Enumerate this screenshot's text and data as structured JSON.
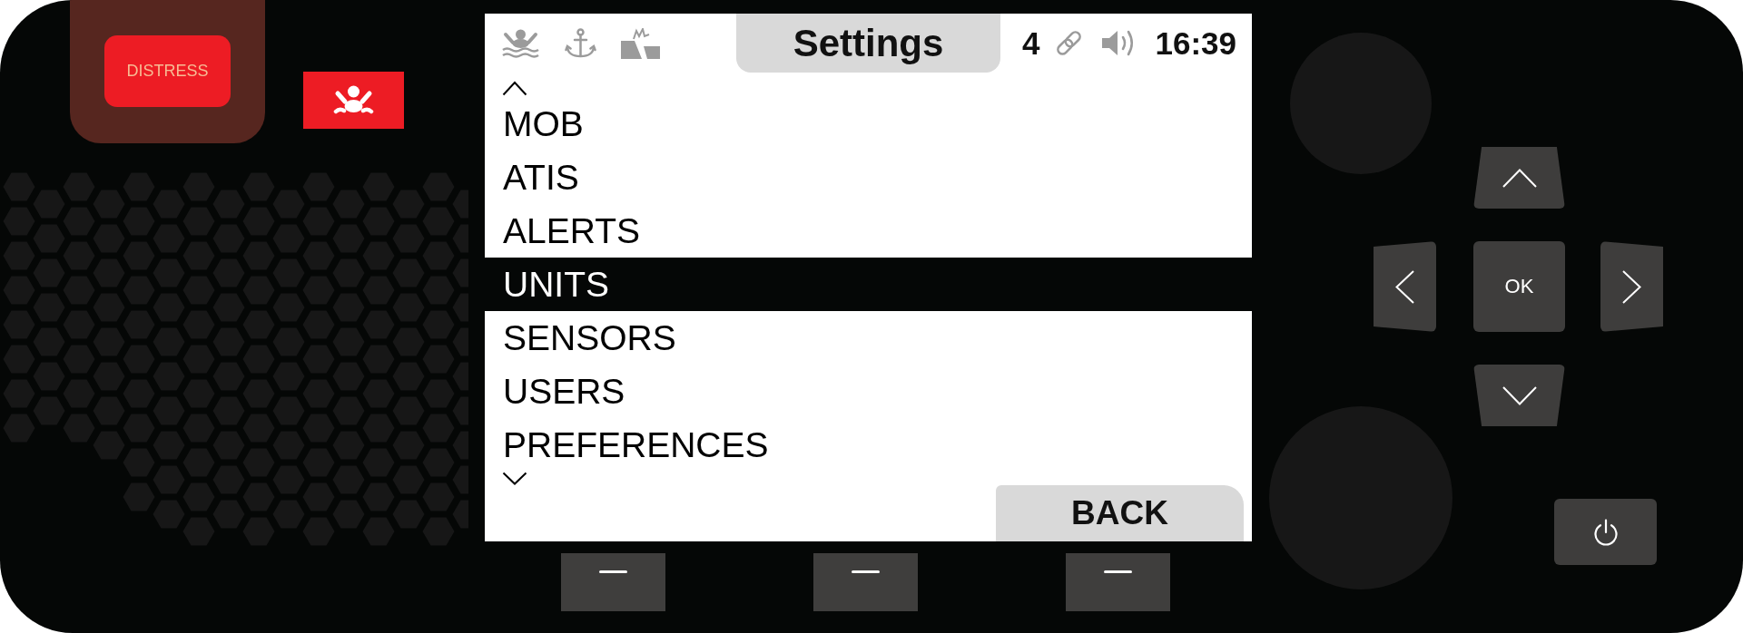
{
  "distress_button": {
    "label": "DISTRESS"
  },
  "screen": {
    "status_bar": {
      "title": "Settings",
      "link_count": "4",
      "time": "16:39"
    },
    "menu": {
      "more_above": true,
      "more_below": true,
      "items": [
        {
          "label": "MOB",
          "selected": false
        },
        {
          "label": "ATIS",
          "selected": false
        },
        {
          "label": "ALERTS",
          "selected": false
        },
        {
          "label": "UNITS",
          "selected": true
        },
        {
          "label": "SENSORS",
          "selected": false
        },
        {
          "label": "USERS",
          "selected": false
        },
        {
          "label": "PREFERENCES",
          "selected": false
        }
      ]
    },
    "back_button": {
      "label": "BACK"
    }
  },
  "keypad": {
    "ok_button": {
      "label": "OK"
    }
  }
}
